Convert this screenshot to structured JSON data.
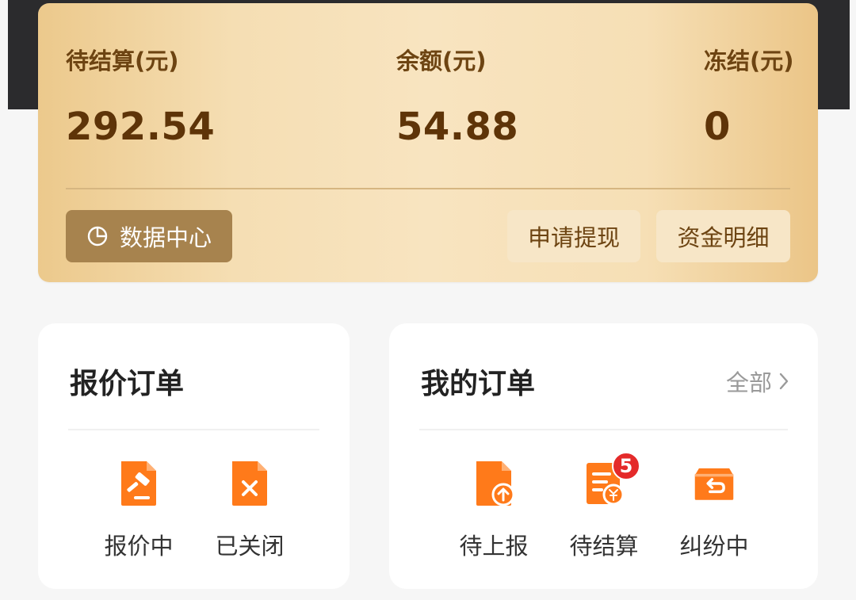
{
  "balance": {
    "pending": {
      "label": "待结算(元)",
      "value": "292.54"
    },
    "balance": {
      "label": "余额(元)",
      "value": "54.88"
    },
    "frozen": {
      "label": "冻结(元)",
      "value": "0"
    },
    "data_center_label": "数据中心",
    "withdraw_label": "申请提现",
    "details_label": "资金明细"
  },
  "quote_orders": {
    "title": "报价订单",
    "items": [
      {
        "label": "报价中",
        "icon": "auction-hammer-icon"
      },
      {
        "label": "已关闭",
        "icon": "closed-document-icon"
      }
    ]
  },
  "my_orders": {
    "title": "我的订单",
    "see_all": "全部",
    "items": [
      {
        "label": "待上报",
        "icon": "upload-document-icon"
      },
      {
        "label": "待结算",
        "icon": "yuan-bill-icon",
        "badge": "5"
      },
      {
        "label": "纠纷中",
        "icon": "return-box-icon"
      }
    ]
  },
  "colors": {
    "accent_orange": "#ff7a1a",
    "card_text": "#5e3408",
    "badge_red": "#e42a2a"
  }
}
